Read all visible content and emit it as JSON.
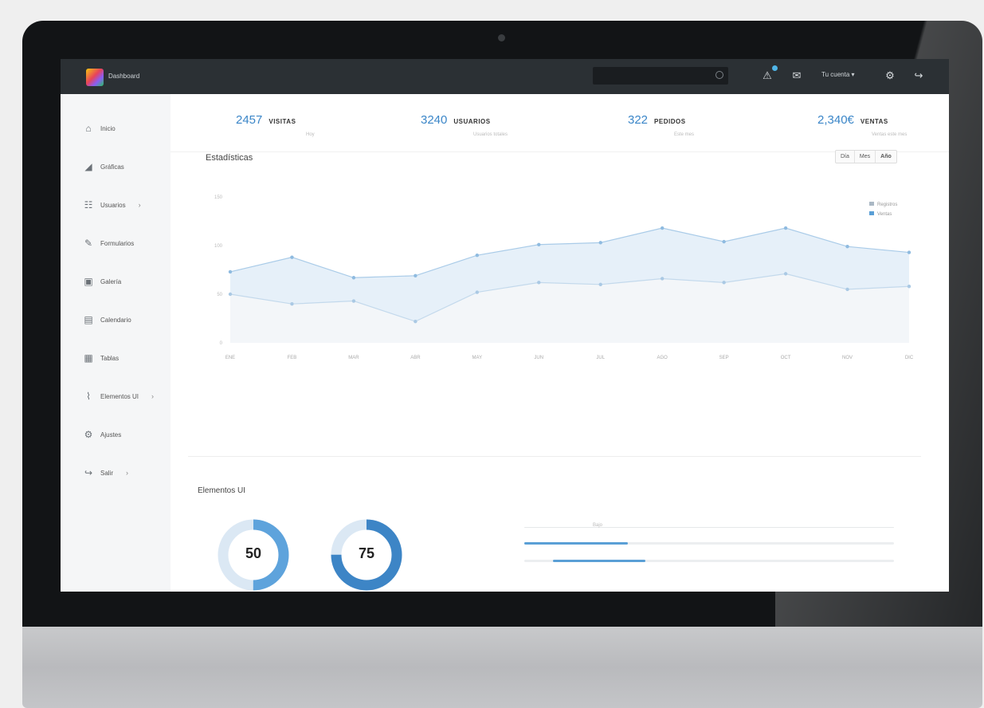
{
  "app": {
    "logo_text": "Dashboard"
  },
  "topbar": {
    "search": {
      "placeholder": "",
      "value": ""
    },
    "user_label": "Tu cuenta ▾"
  },
  "sidebar": {
    "items": [
      {
        "label": "Inicio",
        "icon": "home-icon",
        "glyph": "⌂"
      },
      {
        "label": "Gráficas",
        "icon": "chart-icon",
        "glyph": "◢"
      },
      {
        "label": "Usuarios",
        "icon": "users-icon",
        "glyph": "☷",
        "chevron": "›"
      },
      {
        "label": "Formularios",
        "icon": "pencil-icon",
        "glyph": "✎"
      },
      {
        "label": "Galería",
        "icon": "image-icon",
        "glyph": "▣"
      },
      {
        "label": "Calendario",
        "icon": "calendar-icon",
        "glyph": "▤"
      },
      {
        "label": "Tablas",
        "icon": "table-icon",
        "glyph": "▦"
      },
      {
        "label": "Elementos UI",
        "icon": "tag-icon",
        "glyph": "⌇",
        "chevron": "›"
      },
      {
        "label": "Ajustes",
        "icon": "settings-icon",
        "glyph": "⚙"
      },
      {
        "label": "Salir",
        "icon": "logout-icon",
        "glyph": "↪",
        "chevron": "›"
      }
    ]
  },
  "stats": [
    {
      "value": "2457",
      "label": "VISITAS",
      "sub": "Hoy"
    },
    {
      "value": "3240",
      "label": "USUARIOS",
      "sub": "Usuarios totales"
    },
    {
      "value": "322",
      "label": "PEDIDOS",
      "sub": "Este mes"
    },
    {
      "value": "2,340€",
      "label": "VENTAS",
      "sub": "Ventas este mes"
    }
  ],
  "chart_section": {
    "title": "Estadísticas",
    "ranges": [
      "Día",
      "Mes",
      "Año"
    ]
  },
  "chart_data": {
    "type": "area",
    "title": "Estadísticas",
    "categories": [
      "ENE",
      "FEB",
      "MAR",
      "ABR",
      "MAY",
      "JUN",
      "JUL",
      "AGO",
      "SEP",
      "OCT",
      "NOV",
      "DIC"
    ],
    "ylim": [
      0,
      150
    ],
    "ytick_labels": [
      "0",
      "50",
      "100",
      "150"
    ],
    "series": [
      {
        "name": "Registros",
        "color": "#b9d6ee",
        "values": [
          73,
          88,
          67,
          69,
          90,
          101,
          103,
          118,
          104,
          118,
          99,
          93
        ]
      },
      {
        "name": "Ventas",
        "color": "#9ec4e4",
        "values": [
          50,
          40,
          43,
          22,
          52,
          62,
          60,
          66,
          62,
          71,
          55,
          58
        ]
      }
    ],
    "legend_position": "top-right",
    "grid": false
  },
  "ui_section": {
    "title": "Elementos UI",
    "donuts": [
      {
        "value": 50,
        "label": "50"
      },
      {
        "value": 75,
        "label": "75"
      }
    ],
    "progress": [
      {
        "value": 0.28,
        "label": "Bajo"
      },
      {
        "value": 0.25
      }
    ]
  },
  "colors": {
    "accent": "#3b86c8",
    "topbar": "#2b3034",
    "sidebar": "#f5f6f7"
  }
}
